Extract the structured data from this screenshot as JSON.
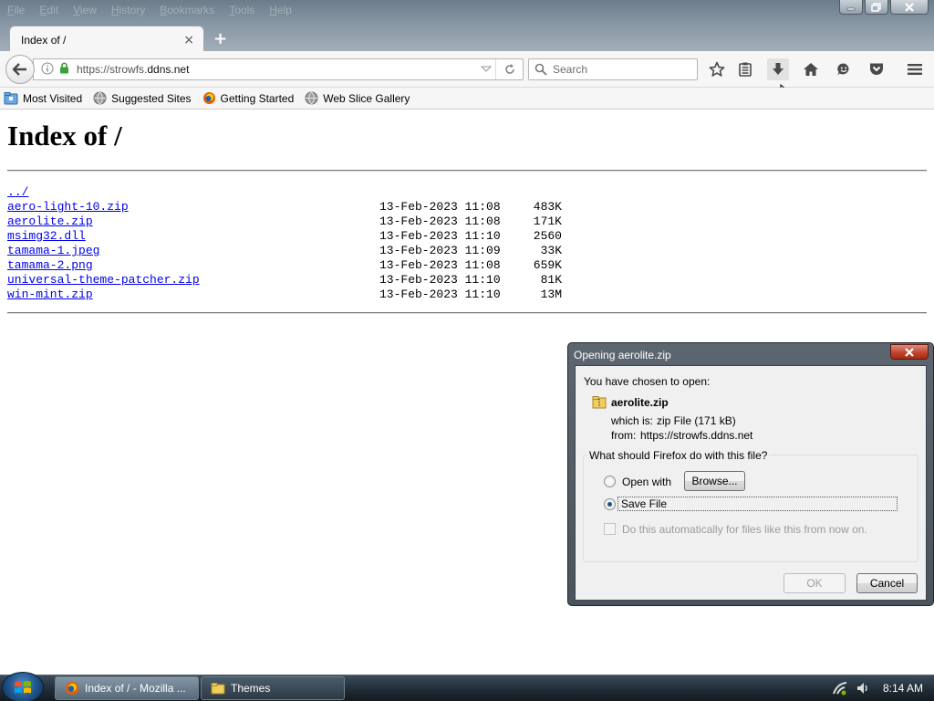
{
  "menubar": {
    "items": [
      "File",
      "Edit",
      "View",
      "History",
      "Bookmarks",
      "Tools",
      "Help"
    ]
  },
  "tab": {
    "title": "Index of /",
    "close_glyph": "×",
    "new_tab_glyph": "+"
  },
  "navbar": {
    "url_host_prefix": "https://strowfs.",
    "url_host_main": "ddns.net",
    "search_placeholder": "Search"
  },
  "bookmarks": [
    "Most Visited",
    "Suggested Sites",
    "Getting Started",
    "Web Slice Gallery"
  ],
  "page": {
    "title": "Index of /",
    "parent_link": "../",
    "entries": [
      {
        "name": "aero-light-10.zip",
        "date": "13-Feb-2023 11:08",
        "size": "483K"
      },
      {
        "name": "aerolite.zip",
        "date": "13-Feb-2023 11:08",
        "size": "171K"
      },
      {
        "name": "msimg32.dll",
        "date": "13-Feb-2023 11:10",
        "size": "2560"
      },
      {
        "name": "tamama-1.jpeg",
        "date": "13-Feb-2023 11:09",
        "size": "33K"
      },
      {
        "name": "tamama-2.png",
        "date": "13-Feb-2023 11:08",
        "size": "659K"
      },
      {
        "name": "universal-theme-patcher.zip",
        "date": "13-Feb-2023 11:10",
        "size": "81K"
      },
      {
        "name": "win-mint.zip",
        "date": "13-Feb-2023 11:10",
        "size": "13M"
      }
    ]
  },
  "dialog": {
    "title": "Opening aerolite.zip",
    "chosen_label": "You have chosen to open:",
    "file_name": "aerolite.zip",
    "which_is_label": "which is:",
    "which_is_value": "zip File (171 kB)",
    "from_label": "from:",
    "from_value": "https://strowfs.ddns.net",
    "question": "What should Firefox do with this file?",
    "open_with_label": "Open with",
    "browse_label": "Browse...",
    "save_file_label": "Save File",
    "auto_label": "Do this automatically for files like this from now on.",
    "ok_label": "OK",
    "cancel_label": "Cancel",
    "selected_option": "save_file"
  },
  "taskbar": {
    "tasks": [
      "Index of / - Mozilla ...",
      "Themes"
    ],
    "clock": "8:14 AM"
  },
  "colors": {
    "link": "#0000ee",
    "dialog_frame": "#4f5962",
    "close_red": "#c1412a"
  }
}
